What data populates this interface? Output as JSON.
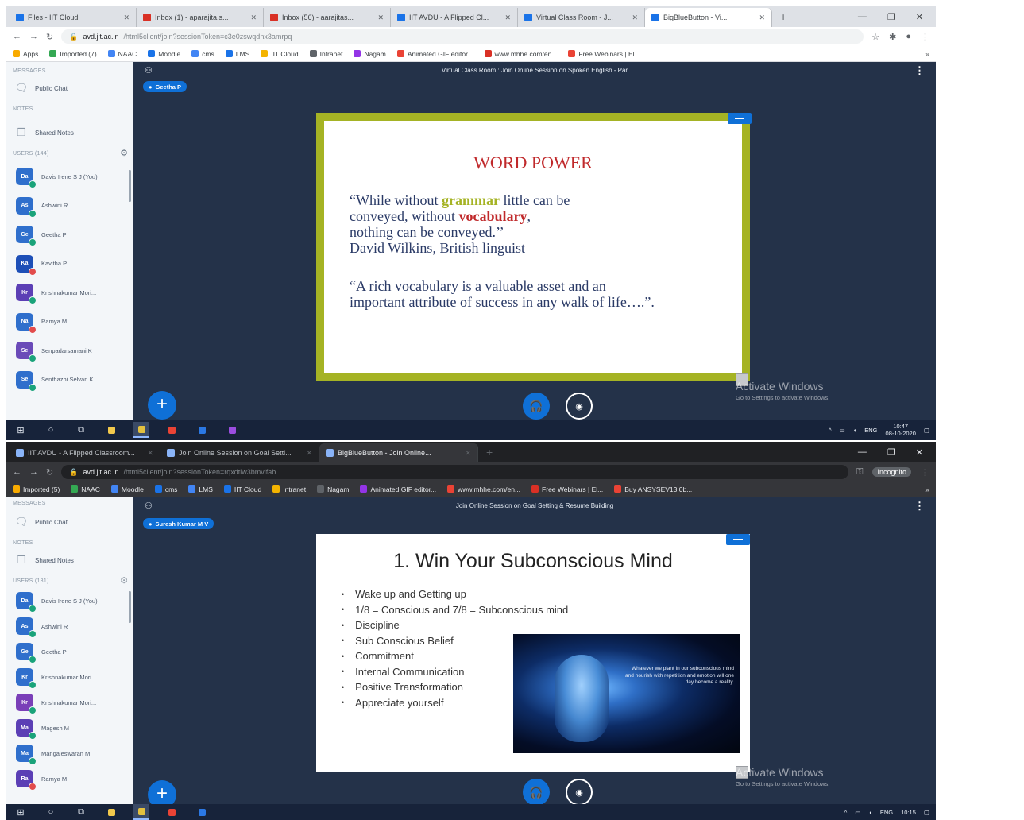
{
  "screen1": {
    "tabs": [
      {
        "label": "Files - IIT Cloud",
        "color": "#1a73e8"
      },
      {
        "label": "Inbox (1) - aparajita.s...",
        "color": "#d93025"
      },
      {
        "label": "Inbox (56) - aarajitas...",
        "color": "#d93025"
      },
      {
        "label": "IIT AVDU - A Flipped Cl...",
        "color": "#1a73e8"
      },
      {
        "label": "Virtual Class Room - J...",
        "color": "#1a73e8"
      },
      {
        "label": "BigBlueButton - Vi...",
        "color": "#1a73e8"
      }
    ],
    "url": {
      "domain": "avd.jit.ac.in",
      "rest": "/html5client/join?sessionToken=c3e0zswqdnx3amrpq"
    },
    "bookmarks": [
      "Apps",
      "Imported (7)",
      "NAAC",
      "Moodle",
      "cms",
      "LMS",
      "IIT Cloud",
      "Intranet",
      "Nagam",
      "Animated GIF editor...",
      "www.mhhe.com/en...",
      "Free Webinars | El..."
    ],
    "sidebar": {
      "messages_title": "MESSAGES",
      "public_chat": "Public Chat",
      "notes_title": "NOTES",
      "shared_notes": "Shared Notes",
      "users_title": "USERS (144)",
      "users": [
        {
          "initials": "Da",
          "name": "Davis Irene S J (You)",
          "color": "#2f6fcc",
          "status": "#1aa37a"
        },
        {
          "initials": "As",
          "name": "Ashwini R",
          "color": "#2f6fcc",
          "status": "#1aa37a"
        },
        {
          "initials": "Ge",
          "name": "Geetha P",
          "color": "#2f6fcc",
          "status": "#1aa37a"
        },
        {
          "initials": "Ka",
          "name": "Kavitha P",
          "color": "#1d4fb7",
          "status": "#e24c4c"
        },
        {
          "initials": "Kr",
          "name": "Krishnakumar Mori...",
          "color": "#5b3fb5",
          "status": "#1aa37a"
        },
        {
          "initials": "Na",
          "name": "Ramya M",
          "color": "#2f6fcc",
          "status": "#e24c4c"
        },
        {
          "initials": "Se",
          "name": "Senpadarsamani K",
          "color": "#6a4ab8",
          "status": "#1aa37a"
        },
        {
          "initials": "Se",
          "name": "Senthazhi Selvan K",
          "color": "#2f6fcc",
          "status": "#1aa37a"
        }
      ]
    },
    "meeting_title": "Virtual Class Room : Join Online Session on Spoken English - Par",
    "presenter": "Geetha P",
    "slide": {
      "title": "WORD POWER",
      "q1_a": "“While without ",
      "q1_g": "grammar",
      "q1_b": " little can be",
      "q2_a": "conveyed, without ",
      "q2_r": "vocabulary",
      "q2_b": ",",
      "q3": "nothing can be conveyed.’’",
      "q4": "David Wilkins, British linguist",
      "q5": "“A rich vocabulary is a valuable asset and an",
      "q6": "important attribute of success in any walk of life….”."
    },
    "activate_title": "Activate Windows",
    "activate_sub": "Go to Settings to activate Windows.",
    "tray": {
      "lang": "ENG",
      "time": "10:47",
      "date": "08-10-2020"
    }
  },
  "screen2": {
    "tabs": [
      {
        "label": "IIT AVDU - A Flipped Classroom...",
        "color": "#8ab4f8"
      },
      {
        "label": "Join Online Session on Goal Setti...",
        "color": "#8ab4f8"
      },
      {
        "label": "BigBlueButton - Join Online...",
        "color": "#8ab4f8"
      }
    ],
    "url": {
      "domain": "avd.jit.ac.in",
      "rest": "/html5client/join?sessionToken=rqxdtlw3bmvifab"
    },
    "incognito_label": "Incognito",
    "bookmarks": [
      "Imported (5)",
      "NAAC",
      "Moodle",
      "cms",
      "LMS",
      "IIT Cloud",
      "Intranet",
      "Nagam",
      "Animated GIF editor...",
      "www.mhhe.com/en...",
      "Free Webinars | El...",
      "Buy ANSYSEV13.0b..."
    ],
    "sidebar": {
      "messages_title": "MESSAGES",
      "public_chat": "Public Chat",
      "notes_title": "NOTES",
      "shared_notes": "Shared Notes",
      "users_title": "USERS (131)",
      "users": [
        {
          "initials": "Da",
          "name": "Davis Irene S J (You)",
          "color": "#2f6fcc",
          "status": "#1aa37a"
        },
        {
          "initials": "As",
          "name": "Ashwini R",
          "color": "#2f6fcc",
          "status": "#1aa37a"
        },
        {
          "initials": "Ge",
          "name": "Geetha P",
          "color": "#2f6fcc",
          "status": "#1aa37a"
        },
        {
          "initials": "Kr",
          "name": "Krishnakumar Mori...",
          "color": "#2f6fcc",
          "status": "#1aa37a"
        },
        {
          "initials": "Kr",
          "name": "Krishnakumar Mori...",
          "color": "#7a3fb8",
          "status": "#1aa37a"
        },
        {
          "initials": "Ma",
          "name": "Magesh M",
          "color": "#5b3fb5",
          "status": "#1aa37a"
        },
        {
          "initials": "Ma",
          "name": "Mangaleswaran M",
          "color": "#2f6fcc",
          "status": "#1aa37a"
        },
        {
          "initials": "Ra",
          "name": "Ramya M",
          "color": "#5b3fb5",
          "status": "#e24c4c"
        }
      ]
    },
    "meeting_title": "Join Online Session on Goal Setting & Resume Building",
    "presenter": "Suresh Kumar M V",
    "slide": {
      "title": "1. Win Your Subconscious Mind",
      "bullets": [
        "Wake up and Getting up",
        "1/8 = Conscious and 7/8 = Subconscious mind",
        "Discipline",
        "Sub Conscious Belief",
        "Commitment",
        "Internal Communication",
        "Positive Transformation",
        "Appreciate yourself"
      ],
      "image_quote": "Whatever we plant in our subconscious mind and nourish with repetition and emotion will one day become a reality."
    },
    "activate_title": "Activate Windows",
    "activate_sub": "Go to Settings to activate Windows.",
    "tray": {
      "lang": "ENG",
      "time": "10:15"
    }
  },
  "colors": {
    "bbb_blue": "#0f70d7",
    "bbb_bg": "#243249",
    "sidebar_bg": "#f3f6f9",
    "slide_frame": "#a5b324",
    "word_red": "#c0292b"
  },
  "icons": [
    "chat-icon",
    "notes-icon",
    "gear-icon",
    "user-icon",
    "kebab-icon",
    "plus-icon",
    "headphones-icon",
    "camera-icon",
    "windows-icon",
    "search-icon"
  ]
}
